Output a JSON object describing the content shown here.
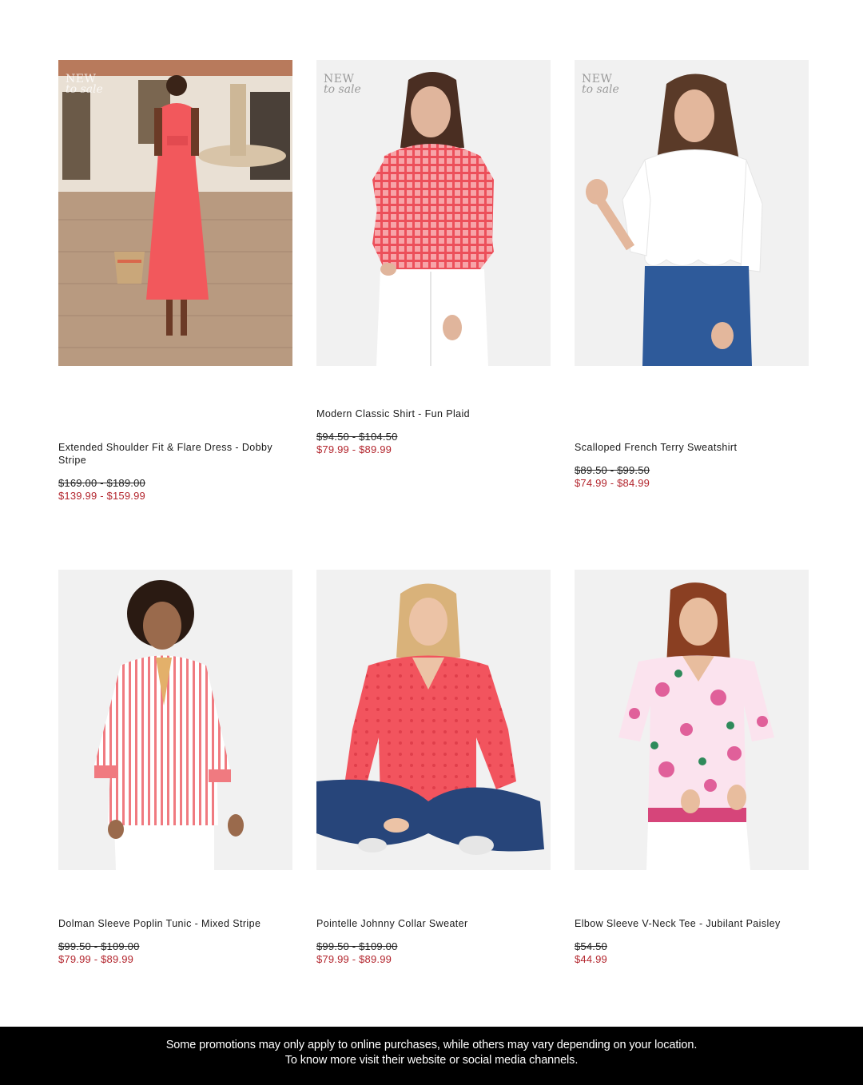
{
  "products": [
    {
      "badge": {
        "line1": "NEW",
        "line2": "to sale"
      },
      "name": "Extended Shoulder Fit & Flare Dress - Dobby Stripe",
      "was_price": "$169.00 - $189.00",
      "now_price": "$139.99 - $159.99"
    },
    {
      "badge": {
        "line1": "NEW",
        "line2": "to sale"
      },
      "name": "Modern Classic Shirt - Fun Plaid",
      "was_price": "$94.50 - $104.50",
      "now_price": "$79.99 - $89.99"
    },
    {
      "badge": {
        "line1": "NEW",
        "line2": "to sale"
      },
      "name": "Scalloped French Terry Sweatshirt",
      "was_price": "$89.50 - $99.50",
      "now_price": "$74.99 - $84.99"
    },
    {
      "name": "Dolman Sleeve Poplin Tunic - Mixed Stripe",
      "was_price": "$99.50 - $109.00",
      "now_price": "$79.99 - $89.99"
    },
    {
      "name": "Pointelle Johnny Collar Sweater",
      "was_price": "$99.50 - $109.00",
      "now_price": "$79.99 - $89.99"
    },
    {
      "name": "Elbow Sleeve V-Neck Tee - Jubilant Paisley",
      "was_price": "$54.50",
      "now_price": "$44.99"
    }
  ],
  "footer": {
    "line1": "Some promotions may only apply to online purchases, while others may vary depending on your location.",
    "line2": "To know more visit their website or social media channels."
  },
  "colors": {
    "sale_price": "#b3262e",
    "footer_bg": "#000000",
    "coral": "#f25a5e"
  }
}
